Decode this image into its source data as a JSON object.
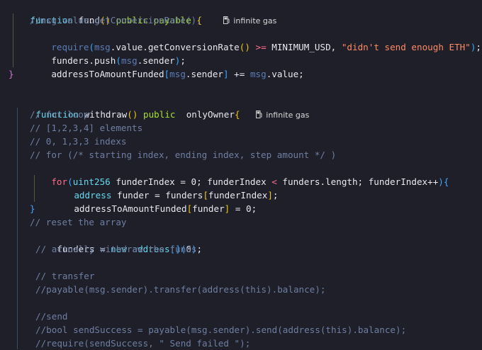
{
  "code": {
    "fund_sig": {
      "kw_function": "function",
      "name": " fund",
      "paren": "()",
      "mods": " public payable ",
      "brace": "{",
      "gas_text": "infinite gas"
    },
    "l2": "//msg.value.getConversionRate();",
    "l3": {
      "require": "require",
      "p1": "(",
      "msg": "msg",
      "rest1": ".value.getConversionRate",
      "p2": "()",
      "gte": ">=",
      "rest2": " MINIMUM_USD, ",
      "str": "\"didn't send enough ETH\"",
      "p3": ")",
      "end": ";"
    },
    "l4": {
      "a": "funders.push",
      "p1": "(",
      "msg": "msg",
      "b": ".sender",
      "p2": ")",
      "end": ";"
    },
    "l5": {
      "a": "addressToAmountFunded",
      "b1": "[",
      "msg": "msg",
      "b": ".sender",
      "b2": "]",
      "op": " += ",
      "msg2": "msg",
      "c": ".value;"
    },
    "l6": "}",
    "withdraw_sig": {
      "kw_function": "function",
      "name": " withdraw",
      "paren": "()",
      "mods": " public  ",
      "owner": "onlyOwner",
      "brace": "{",
      "gas_text": "infinite gas"
    },
    "c1": "// for loop",
    "c2": "// [1,2,3,4] elements",
    "c3": "// 0, 1,3,3 indexs",
    "c4": "// for (/* starting index, ending index, step amount */ )",
    "for_line": {
      "for": "for",
      "p1": "(",
      "uint": "uint256",
      "a": " funderIndex = 0; funderIndex ",
      "lt": "<",
      "b": " funders.length; funderIndex++",
      "p2": ")",
      "brace": "{"
    },
    "addr_line": {
      "addr": "address",
      "a": " funder = funders",
      "b1": "[",
      "idx": "funderIndex",
      "b2": "]",
      "end": ";"
    },
    "atof_line": {
      "a": "addressToAmountFunded",
      "b1": "[",
      "idx": "funder",
      "b2": "]",
      "c": " = 0;"
    },
    "close_for": "}",
    "c5": "// reset the array",
    "reset_line": {
      "a": "funders = ",
      "new": "new",
      "sp": " ",
      "addr": "address",
      "b": "[]",
      "p1": "(",
      "zero": "0",
      "p2": ")",
      "end": ";"
    },
    "c6": "// actually withdraw the funds",
    "c7": "// transfer",
    "c8": "//payable(msg.sender).transfer(address(this).balance);",
    "c9": "//send",
    "c10": "//bool sendSuccess = payable(msg.sender).send(address(this).balance);",
    "c11": "//require(sendSuccess, \" Send failed \");"
  }
}
